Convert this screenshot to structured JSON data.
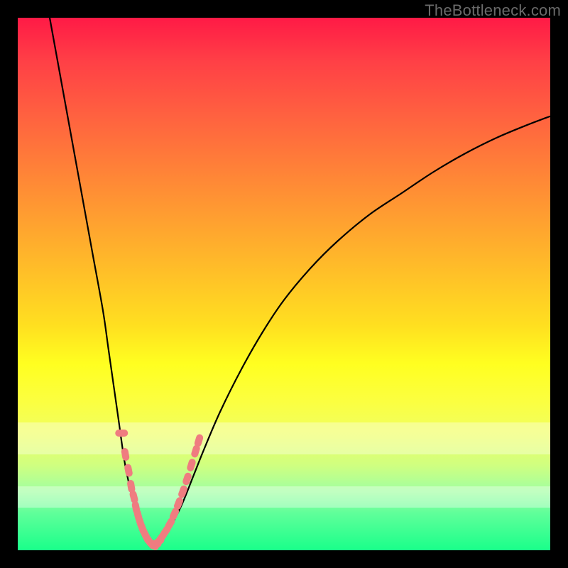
{
  "watermark": "TheBottleneck.com",
  "colors": {
    "frame": "#000000",
    "curve": "#000000",
    "marker": "#ef7c80",
    "gradient_top": "#ff1a46",
    "gradient_bottom": "#1aff8a"
  },
  "chart_data": {
    "type": "line",
    "title": "",
    "xlabel": "",
    "ylabel": "",
    "xlim": [
      0,
      100
    ],
    "ylim": [
      0,
      100
    ],
    "grid": false,
    "legend": false,
    "whitened_bands_y": [
      [
        18,
        24
      ],
      [
        8,
        12
      ]
    ],
    "series": [
      {
        "name": "left-curve",
        "x": [
          6,
          8,
          10,
          12,
          14,
          16,
          17,
          18,
          19,
          20,
          21,
          22,
          23,
          24,
          25
        ],
        "y": [
          100,
          89,
          78,
          67,
          56,
          45,
          38,
          31,
          24,
          17,
          12,
          8,
          5,
          2.5,
          1
        ],
        "style": "line"
      },
      {
        "name": "right-curve",
        "x": [
          25,
          27,
          29,
          31,
          33,
          35,
          38,
          42,
          46,
          50,
          55,
          60,
          66,
          72,
          78,
          84,
          90,
          96,
          100
        ],
        "y": [
          1,
          2,
          5,
          9,
          14,
          19,
          26,
          34,
          41,
          47,
          53,
          58,
          63,
          67,
          71,
          74.5,
          77.5,
          80,
          81.5
        ],
        "style": "line"
      },
      {
        "name": "left-markers",
        "x": [
          19.5,
          20.2,
          20.8,
          21.3,
          21.8,
          22.2,
          22.6,
          23.0,
          23.4,
          23.8,
          24.2,
          24.6,
          25.0,
          25.4
        ],
        "y": [
          22,
          18,
          15,
          12,
          10,
          8,
          6.5,
          5.2,
          4.1,
          3.2,
          2.4,
          1.8,
          1.3,
          1.0
        ],
        "style": "markers"
      },
      {
        "name": "right-markers",
        "x": [
          25.8,
          26.4,
          27.0,
          27.8,
          28.6,
          29.4,
          30.2,
          31.0,
          31.8,
          32.6,
          33.4,
          34.0
        ],
        "y": [
          1.2,
          1.6,
          2.4,
          3.6,
          5.0,
          6.8,
          8.8,
          11.0,
          13.4,
          16.0,
          18.6,
          20.6
        ],
        "style": "markers"
      }
    ]
  }
}
